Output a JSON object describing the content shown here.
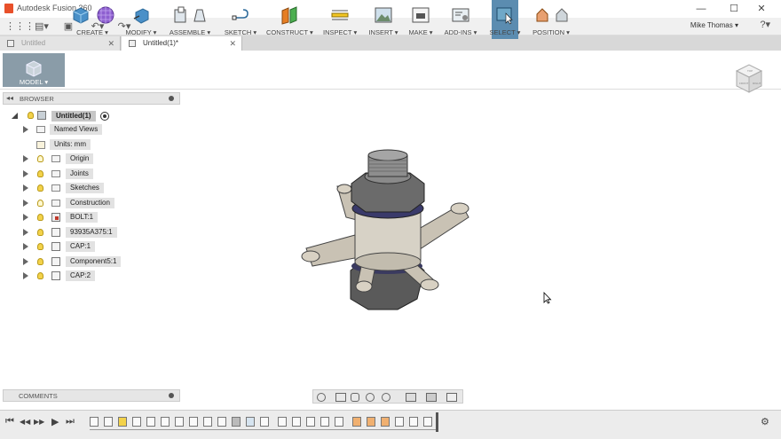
{
  "window": {
    "title": "Autodesk Fusion 360",
    "min": "—",
    "max": "☐",
    "close": "✕"
  },
  "qat": {
    "grid": "⋮⋮⋮",
    "file": "▤▾",
    "save": "▣",
    "undo": "↶▾",
    "redo": "↷▾"
  },
  "user": {
    "name": "Mike Thomas ▾",
    "help": "?▾"
  },
  "tabs": [
    {
      "label": "Untitled",
      "close": "✕"
    },
    {
      "label": "Untitled(1)*",
      "close": "✕"
    }
  ],
  "ribbon": {
    "model": "MODEL ▾",
    "create": "CREATE ▾",
    "modify": "MODIFY ▾",
    "assemble": "ASSEMBLE ▾",
    "sketch": "SKETCH ▾",
    "construct": "CONSTRUCT ▾",
    "inspect": "INSPECT ▾",
    "insert": "INSERT ▾",
    "make": "MAKE ▾",
    "addins": "ADD-INS ▾",
    "select": "SELECT ▾",
    "position": "POSITION ▾"
  },
  "browser": {
    "title": "BROWSER",
    "collapse": "◂◂",
    "root": "Untitled(1)",
    "items": [
      {
        "label": "Named Views"
      },
      {
        "label": "Units: mm"
      },
      {
        "label": "Origin"
      },
      {
        "label": "Joints"
      },
      {
        "label": "Sketches"
      },
      {
        "label": "Construction"
      },
      {
        "label": "BOLT:1"
      },
      {
        "label": "93935A375:1"
      },
      {
        "label": "CAP:1"
      },
      {
        "label": "Component5:1"
      },
      {
        "label": "CAP:2"
      }
    ]
  },
  "comments": {
    "title": "COMMENTS"
  },
  "viewcube": {
    "top": "TOP",
    "front": "FRONT",
    "right": "RIGHT"
  },
  "timeline": {
    "first": "⏮",
    "prev": "◀◀",
    "play": "▶",
    "next": "▶▶",
    "last": "⏭",
    "settings": "⚙"
  }
}
